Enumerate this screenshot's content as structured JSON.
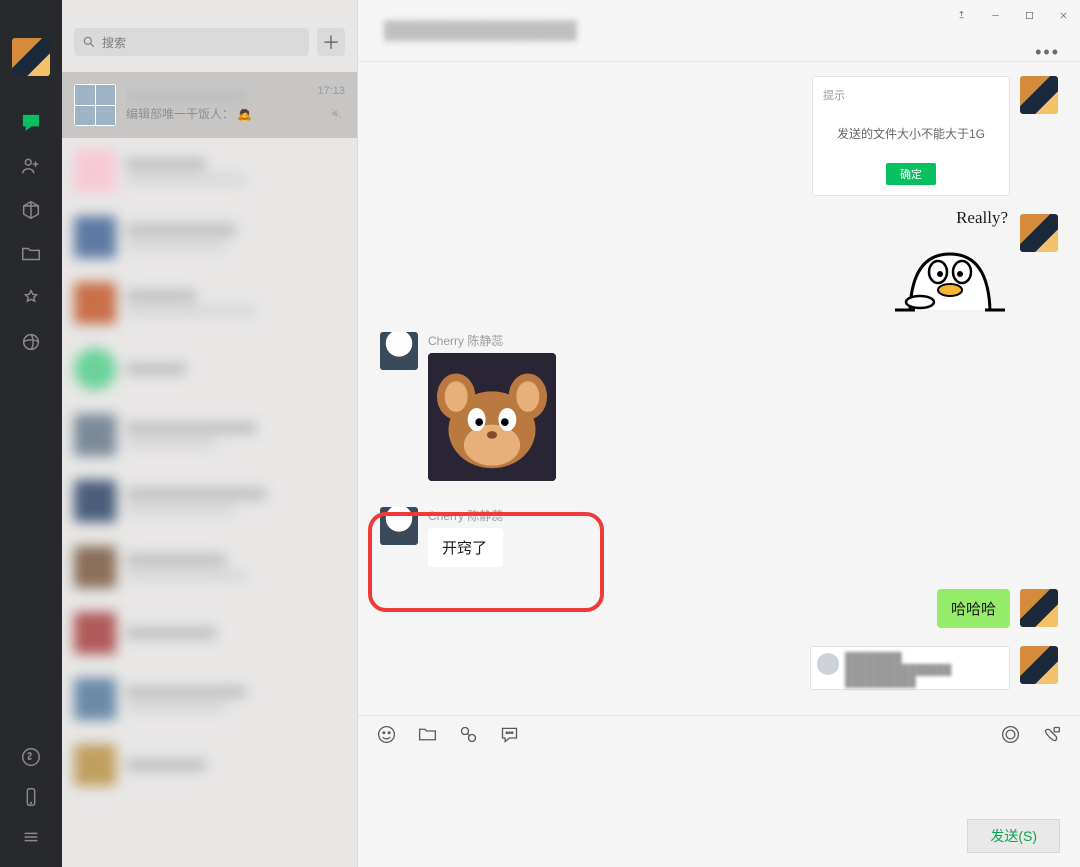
{
  "sidebar": {
    "items": [
      {
        "name": "chat",
        "active": true
      },
      {
        "name": "contacts"
      },
      {
        "name": "favorites"
      },
      {
        "name": "files"
      },
      {
        "name": "discover"
      },
      {
        "name": "moments"
      }
    ]
  },
  "search": {
    "placeholder": "搜索"
  },
  "conversations": {
    "selected": {
      "name": "",
      "preview": "编辑部唯一干饭人：",
      "time": "17:13"
    }
  },
  "chat": {
    "title": "群聊标题",
    "messages": {
      "m1_card": {
        "hint": "提示",
        "body": "发送的文件大小不能大于1G",
        "btn": "确定"
      },
      "m2_sticker_text": "Really?",
      "m3_sender": "Cherry 陈静蕊",
      "m4_sender": "Cherry 陈静蕊",
      "m4_text": "开窍了",
      "m5_text": "哈哈哈"
    }
  },
  "compose": {
    "send": "发送(S)"
  }
}
